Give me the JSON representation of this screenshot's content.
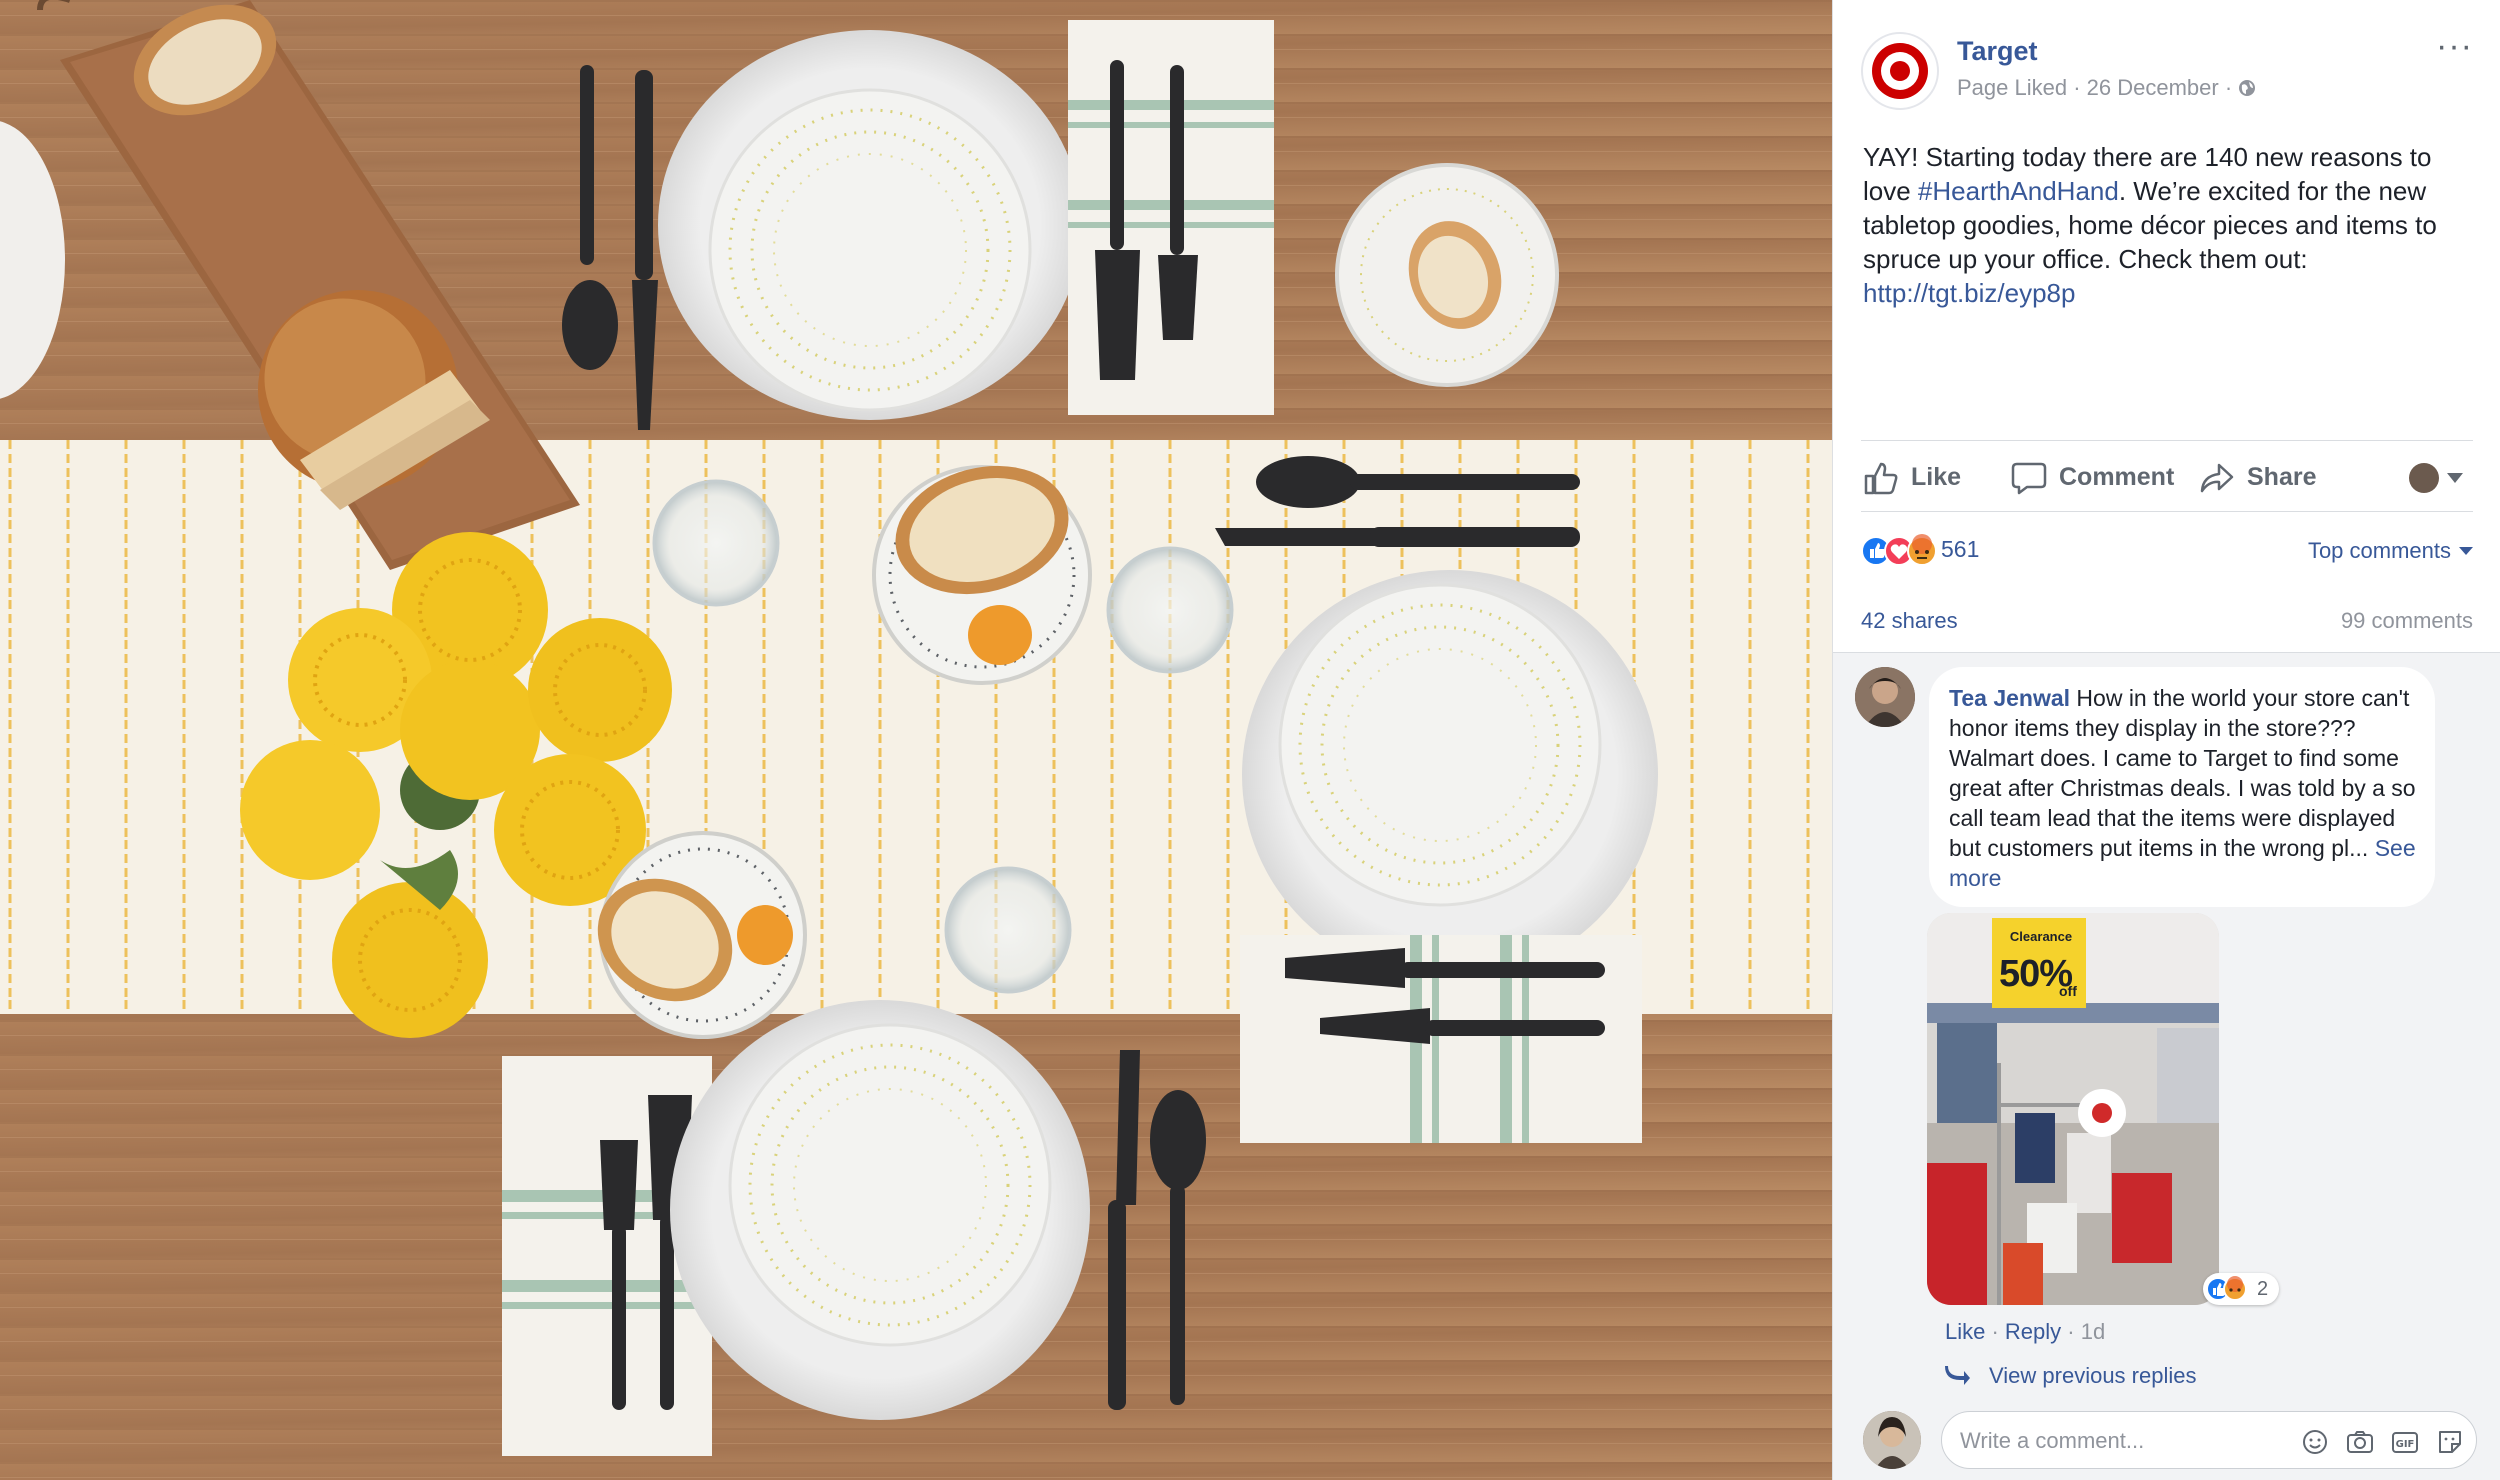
{
  "post": {
    "page_name": "Target",
    "meta": "Page Liked · 26 December ·",
    "more_label": "···",
    "text_1": "YAY! Starting today there are 140 new reasons to love ",
    "hashtag": "#HearthAndHand",
    "text_2": ". We’re excited for the new tabletop goodies, home décor pieces and items to spruce up your office. Check them out: ",
    "link": "http://tgt.biz/eyp8p"
  },
  "actions": {
    "like": "Like",
    "comment": "Comment",
    "share": "Share"
  },
  "reactions": {
    "count": "561",
    "top_comments": "Top comments",
    "shares": "42 shares",
    "comments": "99 comments"
  },
  "comment": {
    "author": "Tea Jenwal",
    "text": " How in the world your store can't honor items they display in the store??? Walmart does. I came to Target to find some great after Christmas deals. I was told by a so call team lead that the items were displayed but customers put items in the wrong pl... ",
    "see_more": "See more",
    "photo_sign_top": "Clearance",
    "photo_sign_big": "50%",
    "photo_sign_small": "off",
    "photo_reaction_count": "2",
    "like": "Like",
    "reply": "Reply",
    "time": "1d",
    "view_replies": "View previous replies"
  },
  "composer": {
    "placeholder": "Write a comment..."
  },
  "colors": {
    "link": "#385898",
    "target_red": "#cc0000",
    "like_blue": "#1877f2",
    "love_red": "#f33e58",
    "comments_bg": "#f2f3f5"
  },
  "icons": [
    "target-logo-icon",
    "globe-icon",
    "like-icon",
    "comment-icon",
    "share-icon",
    "emoji-icon",
    "camera-icon",
    "gif-icon",
    "sticker-icon",
    "reply-arrow-icon"
  ]
}
